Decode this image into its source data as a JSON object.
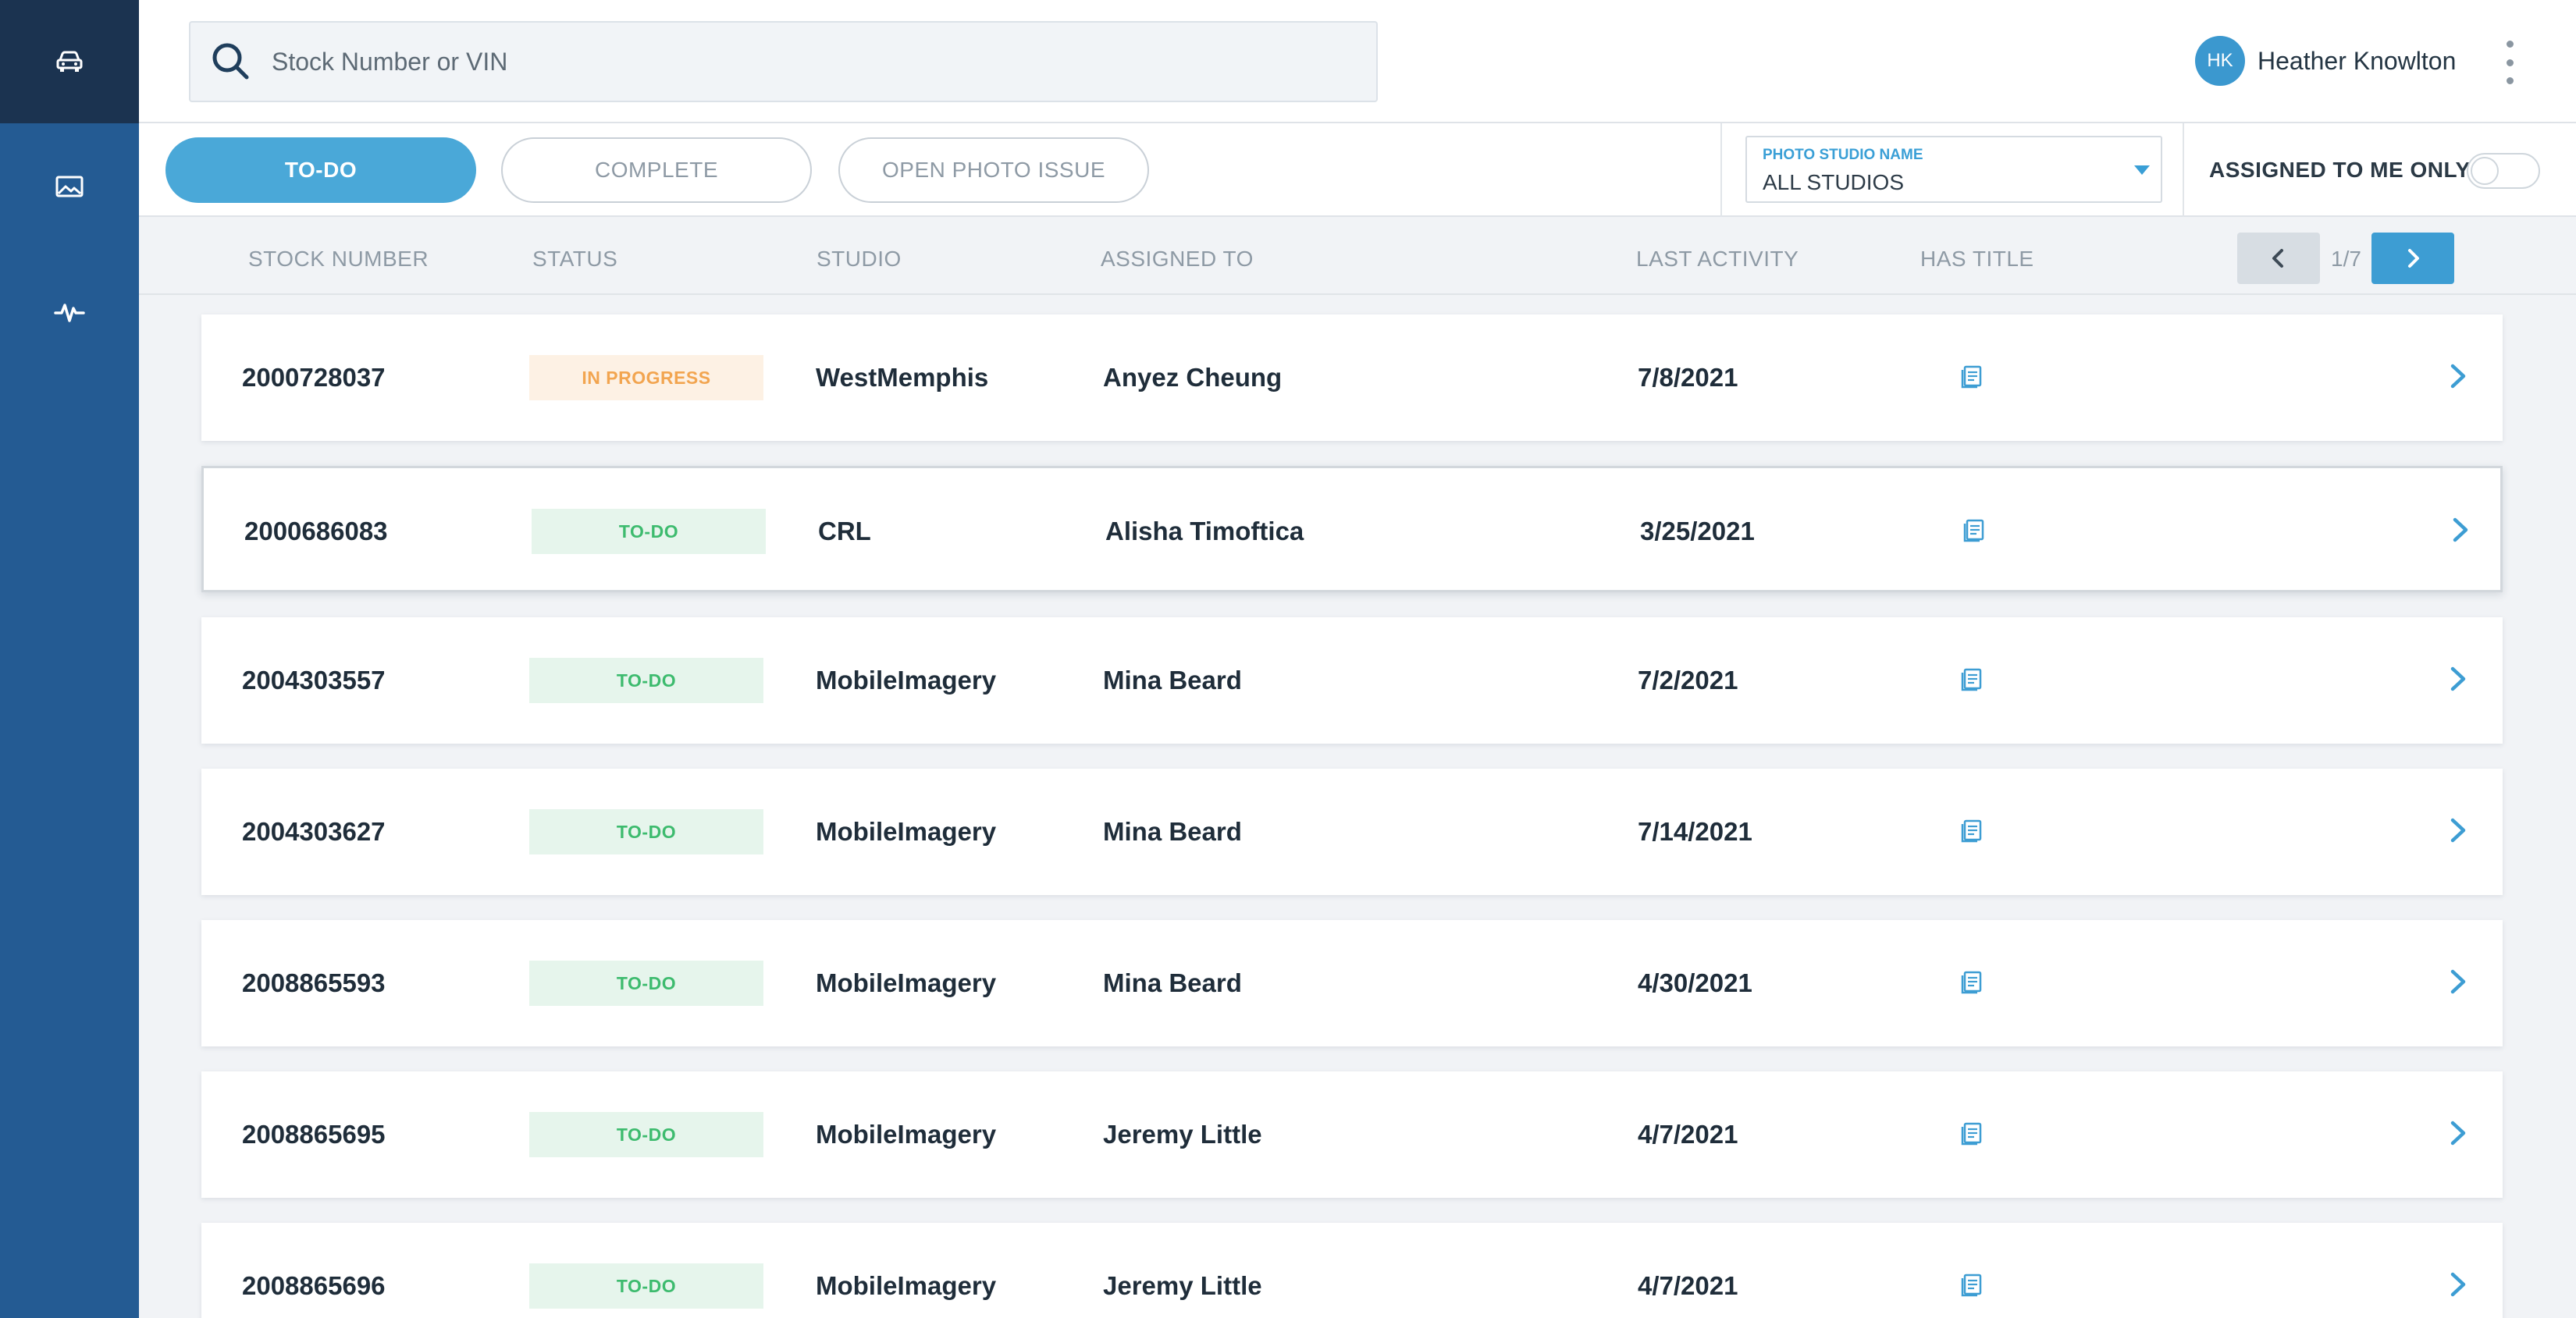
{
  "app": {
    "accent": "#4aa8d8",
    "sidebar_color": "#245b93"
  },
  "sidebar": {
    "items": [
      {
        "icon": "car-icon",
        "active": true
      },
      {
        "icon": "image-icon",
        "active": false
      },
      {
        "icon": "activity-icon",
        "active": false
      }
    ]
  },
  "header": {
    "search_placeholder": "Stock Number or VIN",
    "user_initials": "HK",
    "user_name": "Heather Knowlton"
  },
  "filters": {
    "tabs": [
      {
        "label": "TO-DO",
        "active": true
      },
      {
        "label": "COMPLETE",
        "active": false
      },
      {
        "label": "OPEN PHOTO ISSUE",
        "active": false
      }
    ],
    "studio_label": "PHOTO STUDIO NAME",
    "studio_value": "ALL STUDIOS",
    "assigned_label": "ASSIGNED TO ME ONLY",
    "assigned_on": false
  },
  "table": {
    "columns": [
      "STOCK NUMBER",
      "STATUS",
      "STUDIO",
      "ASSIGNED TO",
      "LAST ACTIVITY",
      "HAS TITLE"
    ],
    "pager": "1/7",
    "rows": [
      {
        "stock": "2000728037",
        "status": "IN PROGRESS",
        "status_kind": "inprogress",
        "studio": "WestMemphis",
        "assignee": "Anyez Cheung",
        "date": "7/8/2021",
        "selected": false
      },
      {
        "stock": "2000686083",
        "status": "TO-DO",
        "status_kind": "todo",
        "studio": "CRL",
        "assignee": "Alisha Timoftica",
        "date": "3/25/2021",
        "selected": true
      },
      {
        "stock": "2004303557",
        "status": "TO-DO",
        "status_kind": "todo",
        "studio": "MobileImagery",
        "assignee": "Mina Beard",
        "date": "7/2/2021",
        "selected": false
      },
      {
        "stock": "2004303627",
        "status": "TO-DO",
        "status_kind": "todo",
        "studio": "MobileImagery",
        "assignee": "Mina Beard",
        "date": "7/14/2021",
        "selected": false
      },
      {
        "stock": "2008865593",
        "status": "TO-DO",
        "status_kind": "todo",
        "studio": "MobileImagery",
        "assignee": "Mina Beard",
        "date": "4/30/2021",
        "selected": false
      },
      {
        "stock": "2008865695",
        "status": "TO-DO",
        "status_kind": "todo",
        "studio": "MobileImagery",
        "assignee": "Jeremy Little",
        "date": "4/7/2021",
        "selected": false
      },
      {
        "stock": "2008865696",
        "status": "TO-DO",
        "status_kind": "todo",
        "studio": "MobileImagery",
        "assignee": "Jeremy Little",
        "date": "4/7/2021",
        "selected": false
      }
    ]
  }
}
